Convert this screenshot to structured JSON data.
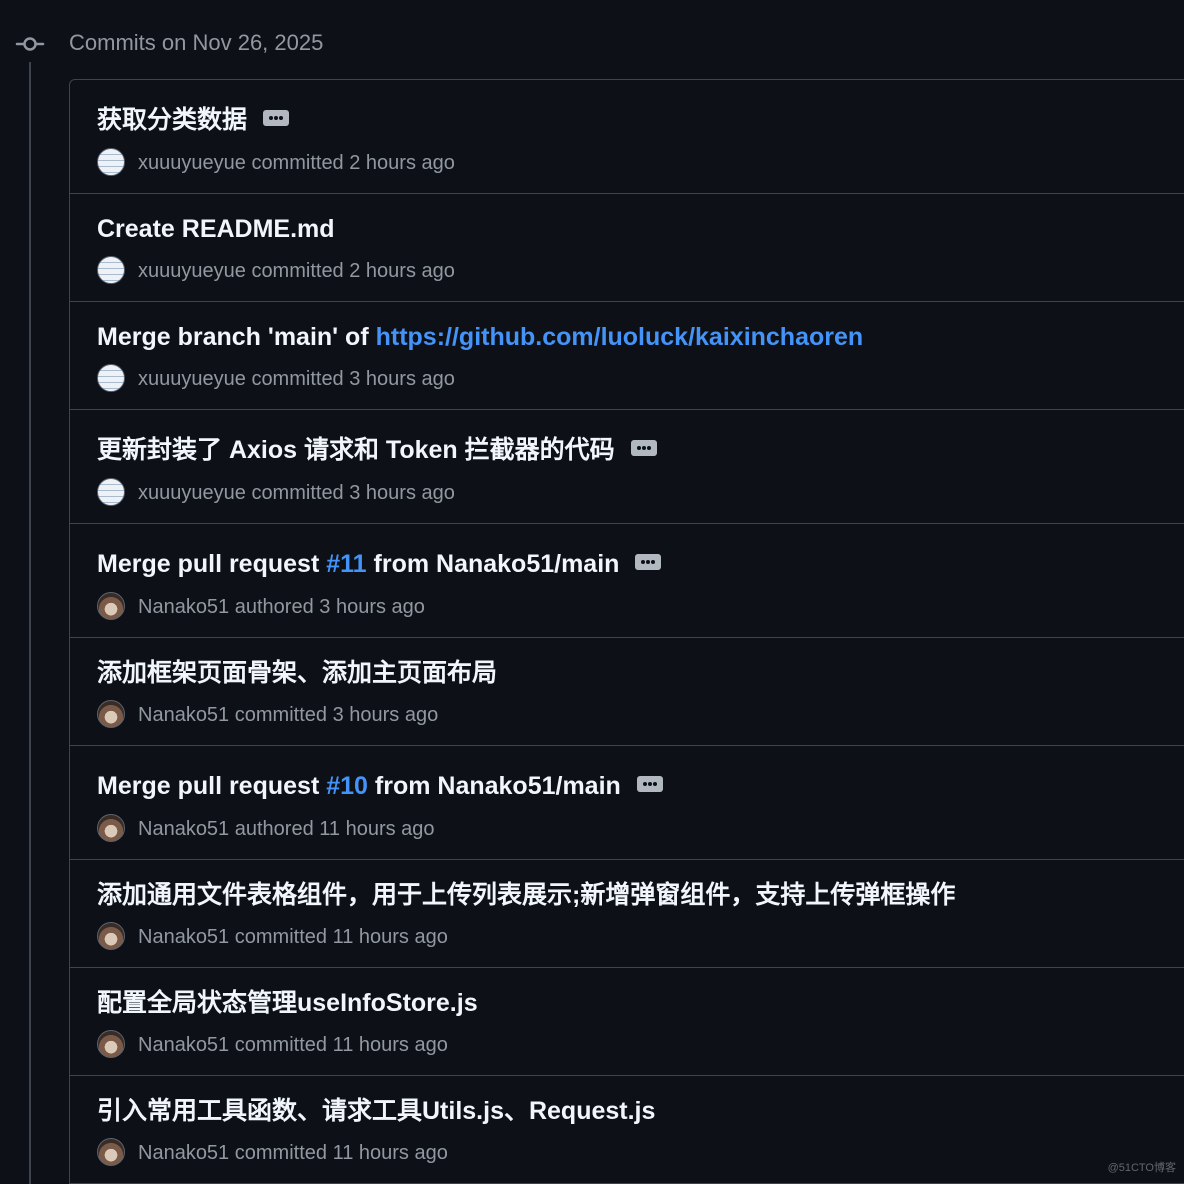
{
  "header": {
    "date_label": "Commits on Nov 26, 2025",
    "icon": "git-commit-icon"
  },
  "colors": {
    "background": "#0d1117",
    "title": "#f0f6fc",
    "link": "#4493f8",
    "muted": "#9198a1",
    "border": "#3d444d"
  },
  "commits": [
    {
      "title": [
        {
          "text": "获取分类数据"
        }
      ],
      "expand_icon": "ellipsis-icon",
      "avatar_icon": "xuuuyueyue-avatar",
      "author": "xuuuyueyue",
      "action": "committed",
      "time": "2 hours ago"
    },
    {
      "title": [
        {
          "text": "Create README.md"
        }
      ],
      "avatar_icon": "xuuuyueyue-avatar",
      "author": "xuuuyueyue",
      "action": "committed",
      "time": "2 hours ago"
    },
    {
      "title": [
        {
          "text": "Merge branch 'main' of "
        },
        {
          "text": "https://github.com/luoluck/kaixinchaoren",
          "link": true
        }
      ],
      "avatar_icon": "xuuuyueyue-avatar",
      "author": "xuuuyueyue",
      "action": "committed",
      "time": "3 hours ago"
    },
    {
      "title": [
        {
          "text": "更新封装了 Axios 请求和 Token 拦截器的代码"
        }
      ],
      "expand_icon": "ellipsis-icon",
      "avatar_icon": "xuuuyueyue-avatar",
      "author": "xuuuyueyue",
      "action": "committed",
      "time": "3 hours ago"
    },
    {
      "title": [
        {
          "text": "Merge pull request "
        },
        {
          "text": "#11",
          "link": true
        },
        {
          "text": " from Nanako51/main"
        }
      ],
      "expand_icon": "ellipsis-icon",
      "avatar_icon": "nanako51-avatar",
      "author": "Nanako51",
      "action": "authored",
      "time": "3 hours ago"
    },
    {
      "title": [
        {
          "text": "添加框架页面骨架、添加主页面布局"
        }
      ],
      "avatar_icon": "nanako51-avatar",
      "author": "Nanako51",
      "action": "committed",
      "time": "3 hours ago"
    },
    {
      "title": [
        {
          "text": "Merge pull request "
        },
        {
          "text": "#10",
          "link": true
        },
        {
          "text": " from Nanako51/main"
        }
      ],
      "expand_icon": "ellipsis-icon",
      "avatar_icon": "nanako51-avatar",
      "author": "Nanako51",
      "action": "authored",
      "time": "11 hours ago"
    },
    {
      "title": [
        {
          "text": "添加通用文件表格组件，用于上传列表展示;新增弹窗组件，支持上传弹框操作"
        }
      ],
      "avatar_icon": "nanako51-avatar",
      "author": "Nanako51",
      "action": "committed",
      "time": "11 hours ago"
    },
    {
      "title": [
        {
          "text": "配置全局状态管理useInfoStore.js"
        }
      ],
      "avatar_icon": "nanako51-avatar",
      "author": "Nanako51",
      "action": "committed",
      "time": "11 hours ago"
    },
    {
      "title": [
        {
          "text": "引入常用工具函数、请求工具Utils.js、Request.js"
        }
      ],
      "avatar_icon": "nanako51-avatar",
      "author": "Nanako51",
      "action": "committed",
      "time": "11 hours ago"
    }
  ],
  "watermark": "@51CTO博客"
}
